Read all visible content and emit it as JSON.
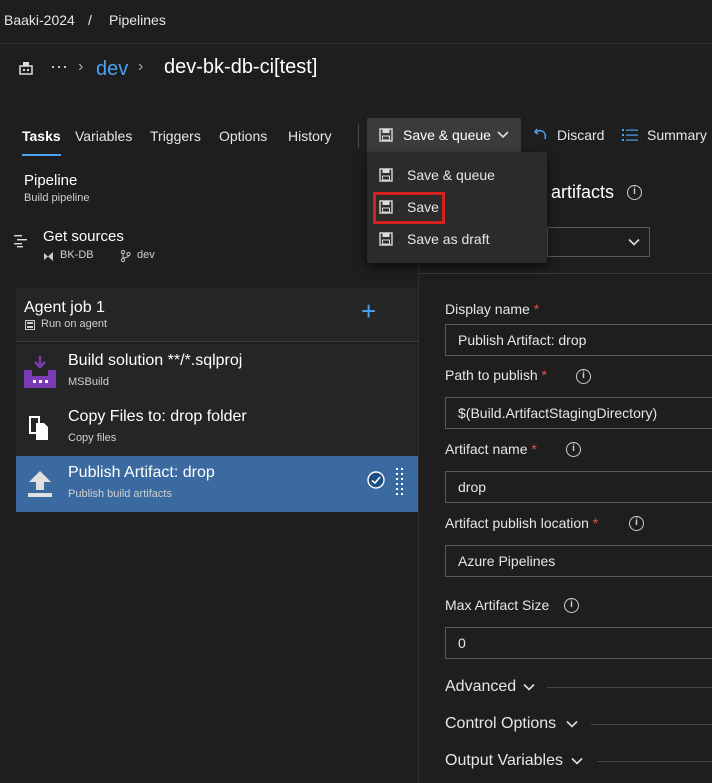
{
  "breadcrumb": {
    "org": "Baaki-2024",
    "sep": "/",
    "section": "Pipelines"
  },
  "title": {
    "ellipsis": "···",
    "parent": "dev",
    "name": "dev-bk-db-ci[test]"
  },
  "tabs": [
    {
      "label": "Tasks"
    },
    {
      "label": "Variables"
    },
    {
      "label": "Triggers"
    },
    {
      "label": "Options"
    },
    {
      "label": "History"
    }
  ],
  "toolbar": {
    "save_queue": "Save & queue",
    "discard": "Discard",
    "summary": "Summary"
  },
  "save_menu": {
    "items": [
      {
        "label": "Save & queue"
      },
      {
        "label": "Save"
      },
      {
        "label": "Save as draft"
      }
    ]
  },
  "pipeline": {
    "title": "Pipeline",
    "subtitle": "Build pipeline"
  },
  "sources": {
    "title": "Get sources",
    "repo": "BK-DB",
    "branch": "dev"
  },
  "agent_job": {
    "title": "Agent job 1",
    "subtitle": "Run on agent"
  },
  "tasks": [
    {
      "name": "Build solution **/*.sqlproj",
      "sub": "MSBuild"
    },
    {
      "name": "Copy Files to: drop folder",
      "sub": "Copy files"
    },
    {
      "name": "Publish Artifact: drop",
      "sub": "Publish build artifacts"
    }
  ],
  "details": {
    "header": "artifacts",
    "display_name": {
      "label": "Display name",
      "required": "*",
      "value": "Publish Artifact: drop"
    },
    "path": {
      "label": "Path to publish",
      "required": "*",
      "value": "$(Build.ArtifactStagingDirectory)"
    },
    "artifact_name": {
      "label": "Artifact name",
      "required": "*",
      "value": "drop"
    },
    "location": {
      "label": "Artifact publish location",
      "required": "*",
      "value": "Azure Pipelines"
    },
    "max_size": {
      "label": "Max Artifact Size",
      "value": "0"
    },
    "sections": {
      "advanced": "Advanced",
      "control": "Control Options",
      "output": "Output Variables"
    }
  },
  "colors": {
    "accent": "#4aa3f0",
    "selected_row": "#3a6aa0",
    "highlight_box": "#d42020",
    "build_icon": "#7a3bb5"
  }
}
